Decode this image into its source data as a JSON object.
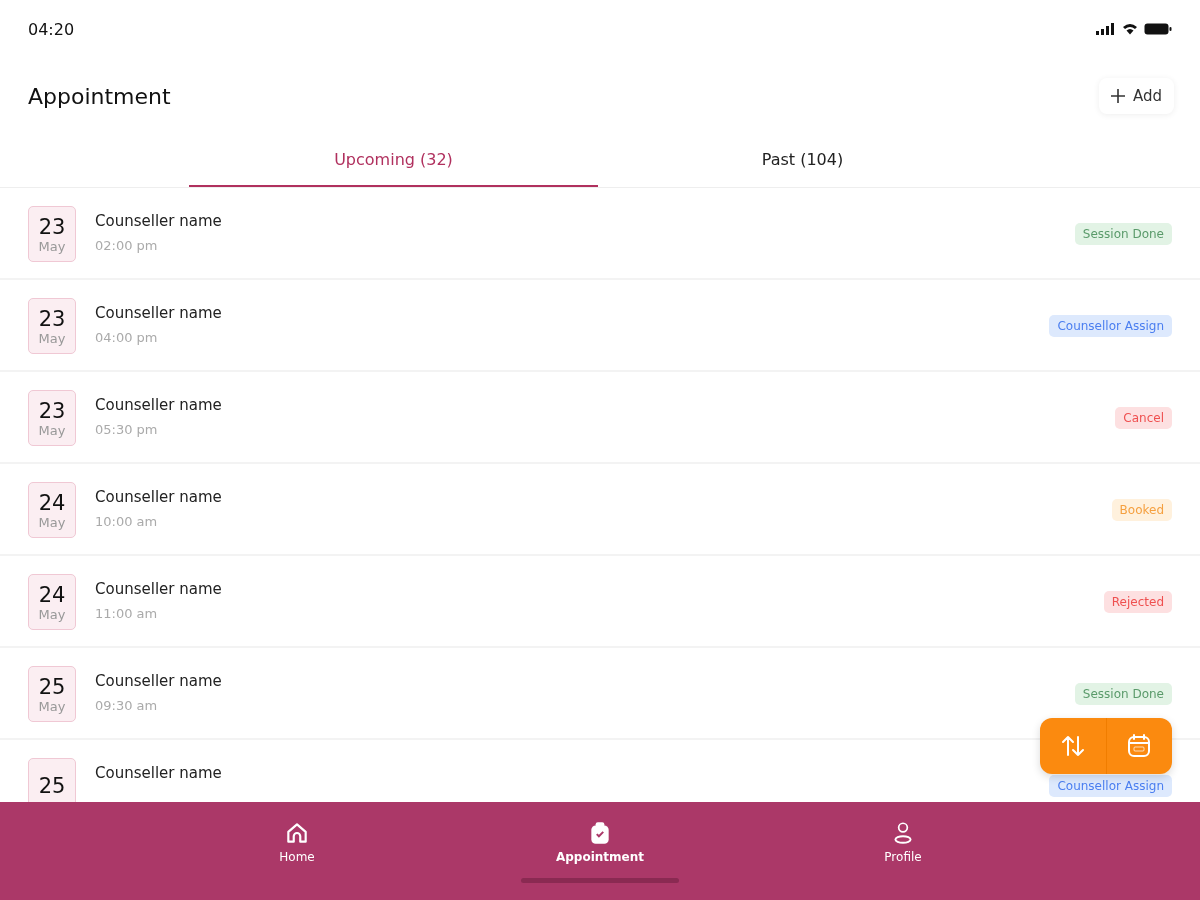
{
  "status_bar": {
    "time": "04:20"
  },
  "header": {
    "title": "Appointment",
    "add_button": "Add"
  },
  "tabs": [
    {
      "label": "Upcoming (32)",
      "selected": true
    },
    {
      "label": "Past (104)",
      "selected": false
    }
  ],
  "appointments": [
    {
      "day": "23",
      "month": "May",
      "name": "Counseller name",
      "time": "02:00 pm",
      "status": {
        "kind": "done",
        "label": "Session Done"
      }
    },
    {
      "day": "23",
      "month": "May",
      "name": "Counseller name",
      "time": "04:00 pm",
      "status": {
        "kind": "assigned",
        "label": "Counsellor Assign"
      }
    },
    {
      "day": "23",
      "month": "May",
      "name": "Counseller name",
      "time": "05:30 pm",
      "status": {
        "kind": "cancel",
        "label": "Cancel"
      }
    },
    {
      "day": "24",
      "month": "May",
      "name": "Counseller name",
      "time": "10:00 am",
      "status": {
        "kind": "booked",
        "label": "Booked"
      }
    },
    {
      "day": "24",
      "month": "May",
      "name": "Counseller name",
      "time": "11:00 am",
      "status": {
        "kind": "rejected",
        "label": "Rejected"
      }
    },
    {
      "day": "25",
      "month": "May",
      "name": "Counseller name",
      "time": "09:30 am",
      "status": {
        "kind": "done",
        "label": "Session Done"
      }
    },
    {
      "day": "25",
      "name": "Counseller name",
      "status": {
        "kind": "assigned",
        "label": "Counsellor Assign"
      }
    }
  ],
  "bottom_nav": [
    {
      "label": "Home",
      "kind": "home",
      "selected": false
    },
    {
      "label": "Appointment",
      "kind": "appointment",
      "selected": true
    },
    {
      "label": "Profile",
      "kind": "profile",
      "selected": false
    }
  ]
}
